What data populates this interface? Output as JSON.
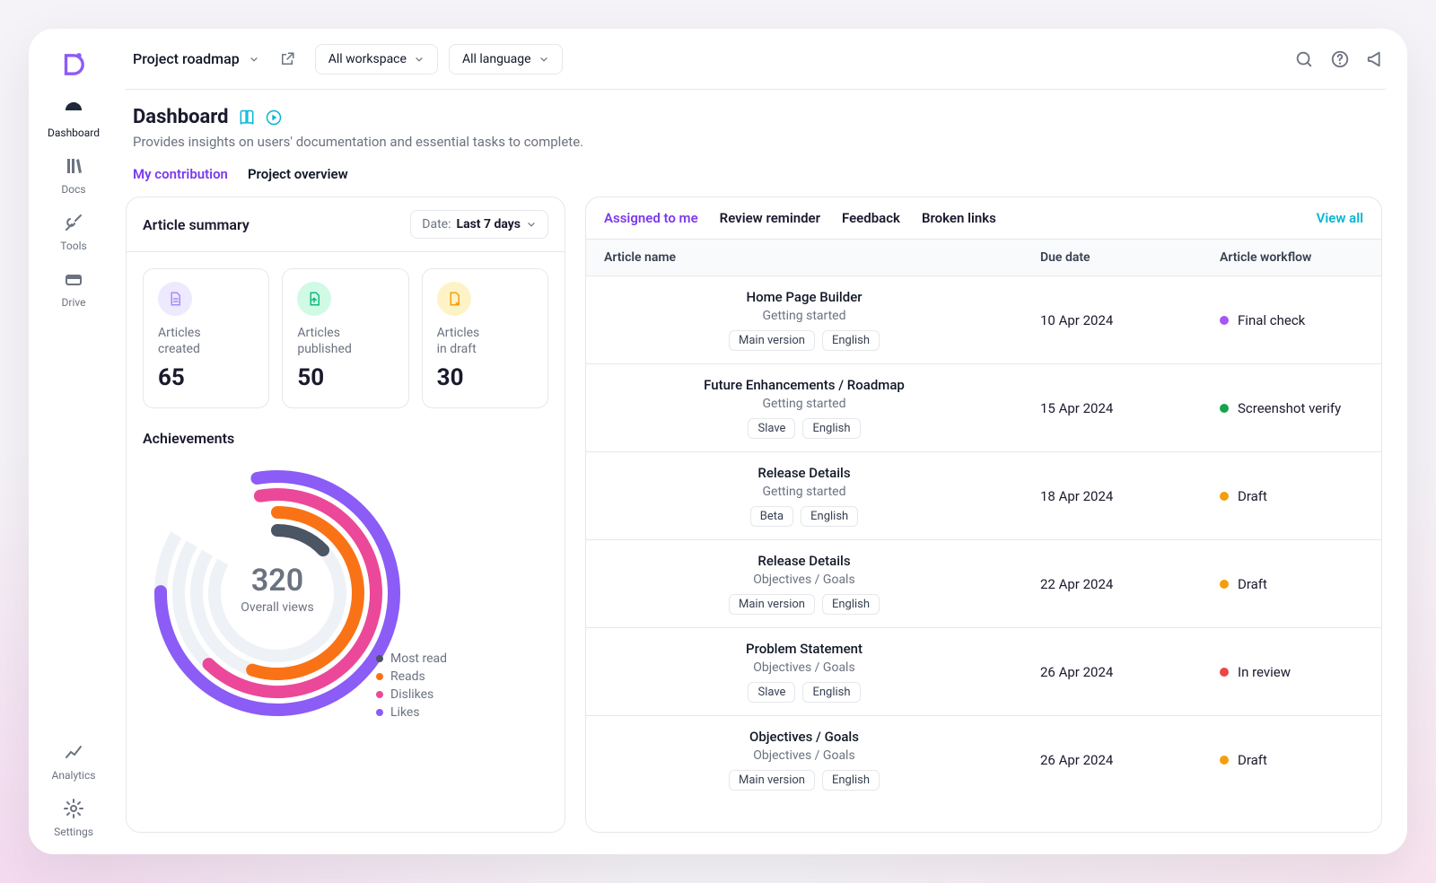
{
  "sidebar": {
    "items": [
      {
        "label": "Dashboard",
        "icon": "gauge",
        "active": true
      },
      {
        "label": "Docs",
        "icon": "books"
      },
      {
        "label": "Tools",
        "icon": "tools"
      },
      {
        "label": "Drive",
        "icon": "drive"
      }
    ],
    "bottom": [
      {
        "label": "Analytics",
        "icon": "analytics"
      },
      {
        "label": "Settings",
        "icon": "gear"
      }
    ]
  },
  "topbar": {
    "crumb": "Project roadmap",
    "filters": [
      {
        "label": "All workspace"
      },
      {
        "label": "All language"
      }
    ]
  },
  "page": {
    "title": "Dashboard",
    "subtitle": "Provides insights on users' documentation and essential tasks to complete.",
    "tabs": [
      {
        "label": "My contribution",
        "active": true
      },
      {
        "label": "Project overview"
      }
    ]
  },
  "summary": {
    "title": "Article summary",
    "date_label": "Date:",
    "date_value": "Last 7 days",
    "stats": [
      {
        "label": "Articles created",
        "value": "65",
        "color": "#a78bfa",
        "bg": "#ede9fe",
        "icon": "file"
      },
      {
        "label": "Articles published",
        "value": "50",
        "color": "#10b981",
        "bg": "#d1fae5",
        "icon": "upload"
      },
      {
        "label": "Articles in draft",
        "value": "30",
        "color": "#f59e0b",
        "bg": "#fef3c7",
        "icon": "draft"
      }
    ]
  },
  "achievements": {
    "title": "Achievements",
    "center_value": "320",
    "center_label": "Overall views",
    "legend": [
      {
        "label": "Most read",
        "color": "#4b5563"
      },
      {
        "label": "Reads",
        "color": "#f97316"
      },
      {
        "label": "Dislikes",
        "color": "#ec4899"
      },
      {
        "label": "Likes",
        "color": "#8b5cf6"
      }
    ]
  },
  "chart_data": {
    "type": "radial-bar",
    "title": "Achievements",
    "center_value": 320,
    "center_label": "Overall views",
    "series": [
      {
        "name": "Most read",
        "color": "#4b5563",
        "fraction": 0.13
      },
      {
        "name": "Reads",
        "color": "#f97316",
        "fraction": 0.55
      },
      {
        "name": "Dislikes",
        "color": "#ec4899",
        "fraction": 0.65
      },
      {
        "name": "Likes",
        "color": "#8b5cf6",
        "fraction": 0.78
      }
    ],
    "note": "fractions are estimated arc sweep proportions read off the chart (no numeric axis present)"
  },
  "table": {
    "tabs": [
      {
        "label": "Assigned to me",
        "active": true
      },
      {
        "label": "Review reminder"
      },
      {
        "label": "Feedback"
      },
      {
        "label": "Broken links"
      }
    ],
    "view_all": "View all",
    "columns": [
      "Article name",
      "Due date",
      "Article workflow"
    ],
    "rows": [
      {
        "title": "Home Page Builder",
        "category": "Getting started",
        "tags": [
          "Main version",
          "English"
        ],
        "due": "10 Apr 2024",
        "workflow": "Final check",
        "wf_color": "#a855f7"
      },
      {
        "title": "Future Enhancements / Roadmap",
        "category": "Getting started",
        "tags": [
          "Slave",
          "English"
        ],
        "due": "15 Apr 2024",
        "workflow": "Screenshot verify",
        "wf_color": "#16a34a"
      },
      {
        "title": "Release Details",
        "category": "Getting started",
        "tags": [
          "Beta",
          "English"
        ],
        "due": "18 Apr 2024",
        "workflow": "Draft",
        "wf_color": "#f59e0b"
      },
      {
        "title": "Release Details",
        "category": "Objectives / Goals",
        "tags": [
          "Main version",
          "English"
        ],
        "due": "22 Apr 2024",
        "workflow": "Draft",
        "wf_color": "#f59e0b"
      },
      {
        "title": "Problem Statement",
        "category": "Objectives / Goals",
        "tags": [
          "Slave",
          "English"
        ],
        "due": "26 Apr 2024",
        "workflow": "In review",
        "wf_color": "#ef4444"
      },
      {
        "title": "Objectives / Goals",
        "category": "Objectives / Goals",
        "tags": [
          "Main version",
          "English"
        ],
        "due": "26 Apr 2024",
        "workflow": "Draft",
        "wf_color": "#f59e0b"
      }
    ]
  }
}
